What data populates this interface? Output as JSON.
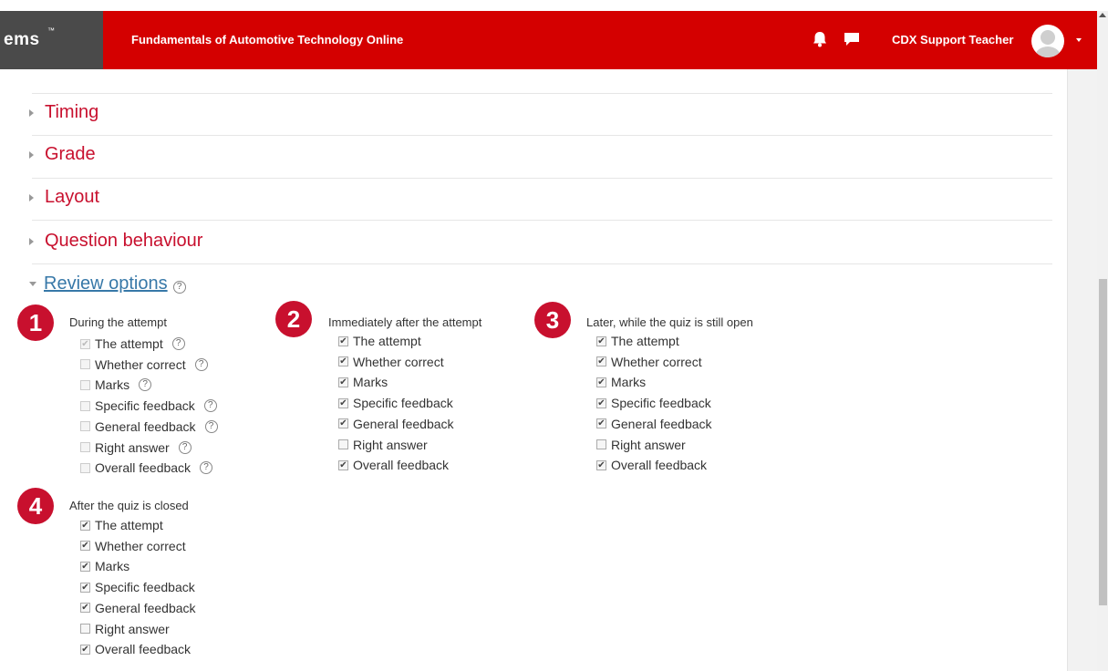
{
  "header": {
    "brand_text": "ems",
    "brand_mark": "™",
    "course_title": "Fundamentals of Automotive Technology Online",
    "user_name": "CDX Support Teacher",
    "icons": [
      "bell-icon",
      "chat-icon",
      "avatar",
      "chevron-down-icon"
    ],
    "colors": {
      "bar": "#d40000",
      "brand_bg": "#4a4a4a"
    }
  },
  "sections": [
    {
      "label": "Timing",
      "expanded": false
    },
    {
      "label": "Grade",
      "expanded": false
    },
    {
      "label": "Layout",
      "expanded": false
    },
    {
      "label": "Question behaviour",
      "expanded": false
    },
    {
      "label": "Review options",
      "expanded": true,
      "help": "?"
    }
  ],
  "groups": [
    {
      "badge": "1",
      "title": "During the attempt",
      "options": [
        {
          "label": "The attempt",
          "checked": true,
          "disabled": true,
          "help": "?"
        },
        {
          "label": "Whether correct",
          "checked": false,
          "disabled": true,
          "help": "?"
        },
        {
          "label": "Marks",
          "checked": false,
          "disabled": true,
          "help": "?"
        },
        {
          "label": "Specific feedback",
          "checked": false,
          "disabled": true,
          "help": "?"
        },
        {
          "label": "General feedback",
          "checked": false,
          "disabled": true,
          "help": "?"
        },
        {
          "label": "Right answer",
          "checked": false,
          "disabled": true,
          "help": "?"
        },
        {
          "label": "Overall feedback",
          "checked": false,
          "disabled": true,
          "help": "?"
        }
      ]
    },
    {
      "badge": "2",
      "title": "Immediately after the attempt",
      "options": [
        {
          "label": "The attempt",
          "checked": true
        },
        {
          "label": "Whether correct",
          "checked": true
        },
        {
          "label": "Marks",
          "checked": true
        },
        {
          "label": "Specific feedback",
          "checked": true
        },
        {
          "label": "General feedback",
          "checked": true
        },
        {
          "label": "Right answer",
          "checked": false
        },
        {
          "label": "Overall feedback",
          "checked": true
        }
      ]
    },
    {
      "badge": "3",
      "title": "Later, while the quiz is still open",
      "options": [
        {
          "label": "The attempt",
          "checked": true
        },
        {
          "label": "Whether correct",
          "checked": true
        },
        {
          "label": "Marks",
          "checked": true
        },
        {
          "label": "Specific feedback",
          "checked": true
        },
        {
          "label": "General feedback",
          "checked": true
        },
        {
          "label": "Right answer",
          "checked": false
        },
        {
          "label": "Overall feedback",
          "checked": true
        }
      ]
    },
    {
      "badge": "4",
      "title": "After the quiz is closed",
      "options": [
        {
          "label": "The attempt",
          "checked": true
        },
        {
          "label": "Whether correct",
          "checked": true
        },
        {
          "label": "Marks",
          "checked": true
        },
        {
          "label": "Specific feedback",
          "checked": true
        },
        {
          "label": "General feedback",
          "checked": true
        },
        {
          "label": "Right answer",
          "checked": false
        },
        {
          "label": "Overall feedback",
          "checked": true
        }
      ]
    }
  ],
  "check_glyph": "✔",
  "colors": {
    "section_link": "#c8102e",
    "review_link": "#3778a8",
    "badge": "#c8102e"
  }
}
